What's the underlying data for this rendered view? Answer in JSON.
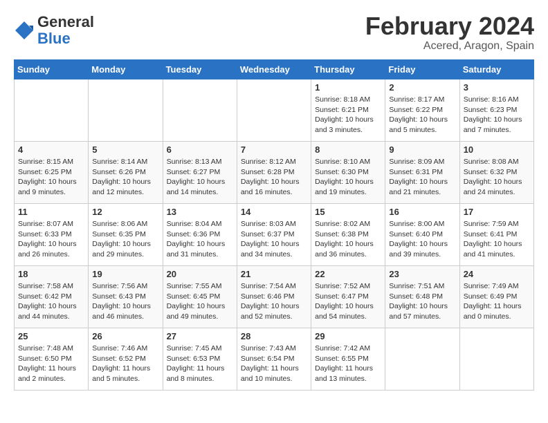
{
  "header": {
    "logo_general": "General",
    "logo_blue": "Blue",
    "month_year": "February 2024",
    "location": "Acered, Aragon, Spain"
  },
  "weekdays": [
    "Sunday",
    "Monday",
    "Tuesday",
    "Wednesday",
    "Thursday",
    "Friday",
    "Saturday"
  ],
  "weeks": [
    [
      {
        "day": "",
        "content": ""
      },
      {
        "day": "",
        "content": ""
      },
      {
        "day": "",
        "content": ""
      },
      {
        "day": "",
        "content": ""
      },
      {
        "day": "1",
        "content": "Sunrise: 8:18 AM\nSunset: 6:21 PM\nDaylight: 10 hours\nand 3 minutes."
      },
      {
        "day": "2",
        "content": "Sunrise: 8:17 AM\nSunset: 6:22 PM\nDaylight: 10 hours\nand 5 minutes."
      },
      {
        "day": "3",
        "content": "Sunrise: 8:16 AM\nSunset: 6:23 PM\nDaylight: 10 hours\nand 7 minutes."
      }
    ],
    [
      {
        "day": "4",
        "content": "Sunrise: 8:15 AM\nSunset: 6:25 PM\nDaylight: 10 hours\nand 9 minutes."
      },
      {
        "day": "5",
        "content": "Sunrise: 8:14 AM\nSunset: 6:26 PM\nDaylight: 10 hours\nand 12 minutes."
      },
      {
        "day": "6",
        "content": "Sunrise: 8:13 AM\nSunset: 6:27 PM\nDaylight: 10 hours\nand 14 minutes."
      },
      {
        "day": "7",
        "content": "Sunrise: 8:12 AM\nSunset: 6:28 PM\nDaylight: 10 hours\nand 16 minutes."
      },
      {
        "day": "8",
        "content": "Sunrise: 8:10 AM\nSunset: 6:30 PM\nDaylight: 10 hours\nand 19 minutes."
      },
      {
        "day": "9",
        "content": "Sunrise: 8:09 AM\nSunset: 6:31 PM\nDaylight: 10 hours\nand 21 minutes."
      },
      {
        "day": "10",
        "content": "Sunrise: 8:08 AM\nSunset: 6:32 PM\nDaylight: 10 hours\nand 24 minutes."
      }
    ],
    [
      {
        "day": "11",
        "content": "Sunrise: 8:07 AM\nSunset: 6:33 PM\nDaylight: 10 hours\nand 26 minutes."
      },
      {
        "day": "12",
        "content": "Sunrise: 8:06 AM\nSunset: 6:35 PM\nDaylight: 10 hours\nand 29 minutes."
      },
      {
        "day": "13",
        "content": "Sunrise: 8:04 AM\nSunset: 6:36 PM\nDaylight: 10 hours\nand 31 minutes."
      },
      {
        "day": "14",
        "content": "Sunrise: 8:03 AM\nSunset: 6:37 PM\nDaylight: 10 hours\nand 34 minutes."
      },
      {
        "day": "15",
        "content": "Sunrise: 8:02 AM\nSunset: 6:38 PM\nDaylight: 10 hours\nand 36 minutes."
      },
      {
        "day": "16",
        "content": "Sunrise: 8:00 AM\nSunset: 6:40 PM\nDaylight: 10 hours\nand 39 minutes."
      },
      {
        "day": "17",
        "content": "Sunrise: 7:59 AM\nSunset: 6:41 PM\nDaylight: 10 hours\nand 41 minutes."
      }
    ],
    [
      {
        "day": "18",
        "content": "Sunrise: 7:58 AM\nSunset: 6:42 PM\nDaylight: 10 hours\nand 44 minutes."
      },
      {
        "day": "19",
        "content": "Sunrise: 7:56 AM\nSunset: 6:43 PM\nDaylight: 10 hours\nand 46 minutes."
      },
      {
        "day": "20",
        "content": "Sunrise: 7:55 AM\nSunset: 6:45 PM\nDaylight: 10 hours\nand 49 minutes."
      },
      {
        "day": "21",
        "content": "Sunrise: 7:54 AM\nSunset: 6:46 PM\nDaylight: 10 hours\nand 52 minutes."
      },
      {
        "day": "22",
        "content": "Sunrise: 7:52 AM\nSunset: 6:47 PM\nDaylight: 10 hours\nand 54 minutes."
      },
      {
        "day": "23",
        "content": "Sunrise: 7:51 AM\nSunset: 6:48 PM\nDaylight: 10 hours\nand 57 minutes."
      },
      {
        "day": "24",
        "content": "Sunrise: 7:49 AM\nSunset: 6:49 PM\nDaylight: 11 hours\nand 0 minutes."
      }
    ],
    [
      {
        "day": "25",
        "content": "Sunrise: 7:48 AM\nSunset: 6:50 PM\nDaylight: 11 hours\nand 2 minutes."
      },
      {
        "day": "26",
        "content": "Sunrise: 7:46 AM\nSunset: 6:52 PM\nDaylight: 11 hours\nand 5 minutes."
      },
      {
        "day": "27",
        "content": "Sunrise: 7:45 AM\nSunset: 6:53 PM\nDaylight: 11 hours\nand 8 minutes."
      },
      {
        "day": "28",
        "content": "Sunrise: 7:43 AM\nSunset: 6:54 PM\nDaylight: 11 hours\nand 10 minutes."
      },
      {
        "day": "29",
        "content": "Sunrise: 7:42 AM\nSunset: 6:55 PM\nDaylight: 11 hours\nand 13 minutes."
      },
      {
        "day": "",
        "content": ""
      },
      {
        "day": "",
        "content": ""
      }
    ]
  ]
}
